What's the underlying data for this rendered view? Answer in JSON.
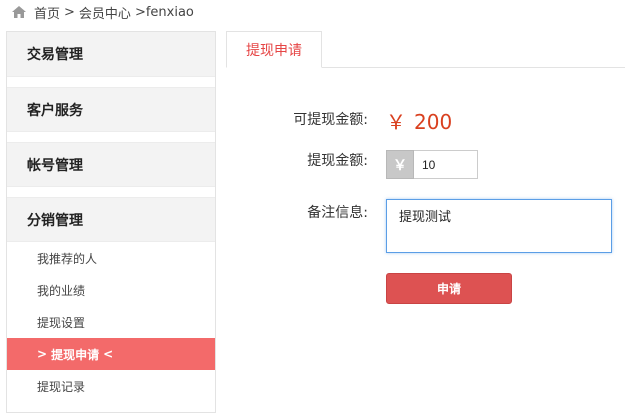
{
  "breadcrumb": {
    "icon": "home-icon",
    "items": [
      "首页",
      "会员中心",
      "fenxiao"
    ],
    "separator": ">"
  },
  "sidebar": {
    "groups": [
      {
        "label": "交易管理"
      },
      {
        "label": "客户服务"
      },
      {
        "label": "帐号管理"
      },
      {
        "label": "分销管理"
      }
    ],
    "sub_items": [
      {
        "label": "我推荐的人"
      },
      {
        "label": "我的业绩"
      },
      {
        "label": "提现设置"
      },
      {
        "label": "提现申请",
        "active": true,
        "prefix": ">",
        "suffix": "<"
      },
      {
        "label": "提现记录"
      }
    ]
  },
  "tabs": [
    {
      "label": "提现申请",
      "active": true
    }
  ],
  "form": {
    "available_label": "可提现金额:",
    "available_currency": "￥",
    "available_amount": "200",
    "amount_label": "提现金额:",
    "amount_addon": "￥",
    "amount_value": "10",
    "note_label": "备注信息:",
    "note_value": "提现测试",
    "submit_label": "申请"
  },
  "colors": {
    "accent": "#e64545",
    "active_bg": "#f36a6a",
    "button_bg": "#dd5252",
    "amount_text": "#d9401f"
  }
}
